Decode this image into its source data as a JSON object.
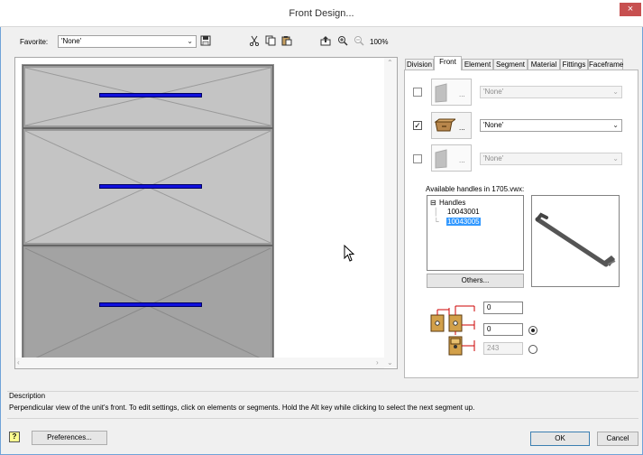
{
  "window": {
    "title": "Front Design...",
    "close_glyph": "×"
  },
  "toolbar": {
    "favorite_label": "Favorite:",
    "favorite_value": "'None'",
    "zoom_level": "100%",
    "icons": [
      "save-icon",
      "cut-icon",
      "copy-icon",
      "paste-icon",
      "export-icon",
      "zoom-in-icon",
      "zoom-out-icon"
    ]
  },
  "tabs": [
    {
      "label": "Division",
      "active": false
    },
    {
      "label": "Front",
      "active": true
    },
    {
      "label": "Element",
      "active": false
    },
    {
      "label": "Segment",
      "active": false
    },
    {
      "label": "Material",
      "active": false
    },
    {
      "label": "Fittings",
      "active": false
    },
    {
      "label": "Faceframe",
      "active": false
    }
  ],
  "front_tab": {
    "rows": [
      {
        "checked": false,
        "enabled": false,
        "ellipsis": "...",
        "value": "'None'"
      },
      {
        "checked": true,
        "enabled": true,
        "ellipsis": "...",
        "value": "'None'"
      },
      {
        "checked": false,
        "enabled": false,
        "ellipsis": "...",
        "value": "'None'"
      }
    ],
    "available_label": "Available handles in 1705.vwx:",
    "tree": {
      "root": "Handles",
      "items": [
        "10043001",
        "10043005"
      ],
      "selected": "10043005",
      "expander": "⊟"
    },
    "others_button": "Others...",
    "offset_values": {
      "top": "0",
      "middle": "0",
      "bottom": "243"
    },
    "radio_selected": "middle"
  },
  "description": {
    "label": "Description",
    "text": "Perpendicular view of the unit's front. To edit settings, click on elements or segments. Hold the Alt key while clicking to select the next segment up."
  },
  "footer": {
    "help_glyph": "?",
    "preferences": "Preferences...",
    "ok": "OK",
    "cancel": "Cancel"
  },
  "colors": {
    "handle": "#1010dd",
    "accent": "#3399ff",
    "close": "#c75050"
  }
}
